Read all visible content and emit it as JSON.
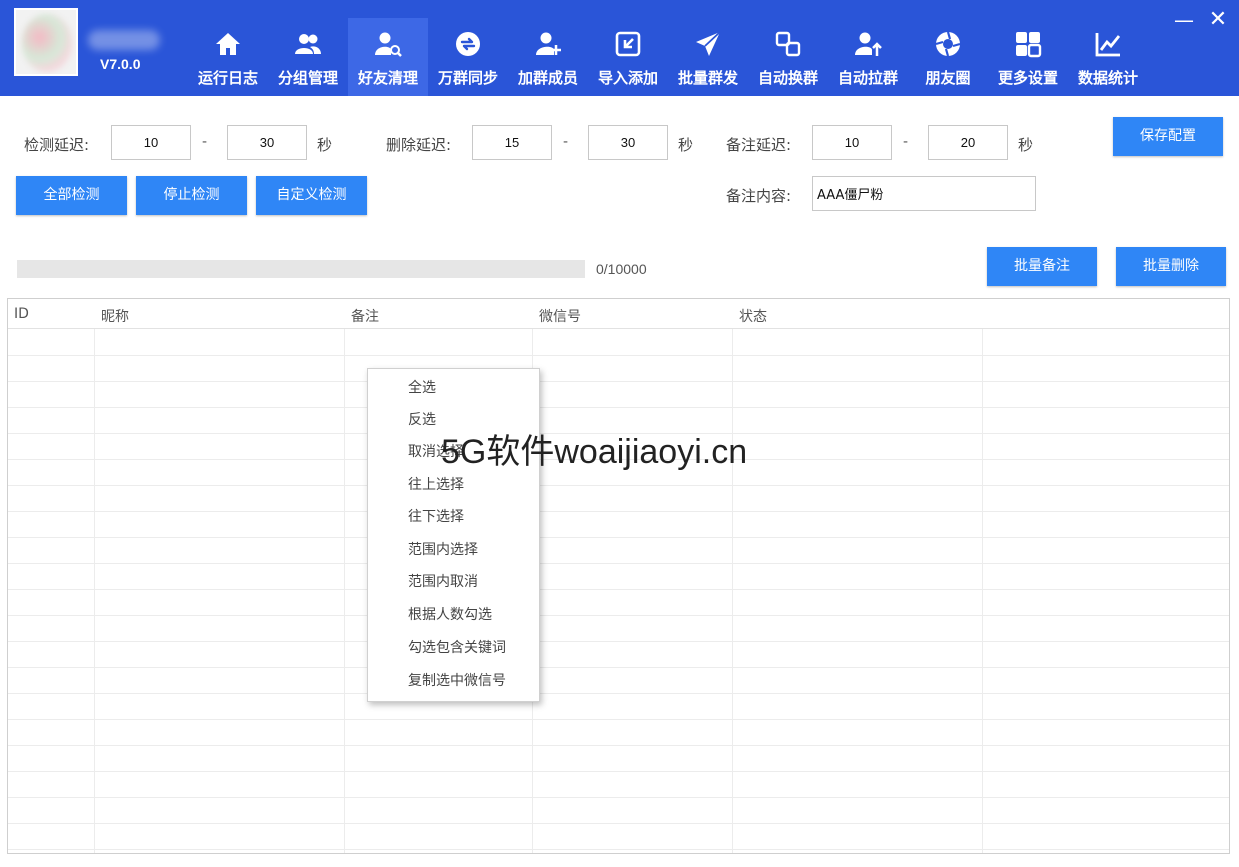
{
  "header": {
    "version": "V7.0.0",
    "nav": [
      {
        "label": "运行日志",
        "icon": "home-icon",
        "active": false
      },
      {
        "label": "分组管理",
        "icon": "users-icon",
        "active": false
      },
      {
        "label": "好友清理",
        "icon": "user-search-icon",
        "active": true
      },
      {
        "label": "万群同步",
        "icon": "sync-icon",
        "active": false
      },
      {
        "label": "加群成员",
        "icon": "user-add-icon",
        "active": false
      },
      {
        "label": "导入添加",
        "icon": "import-icon",
        "active": false
      },
      {
        "label": "批量群发",
        "icon": "send-icon",
        "active": false
      },
      {
        "label": "自动换群",
        "icon": "swap-icon",
        "active": false
      },
      {
        "label": "自动拉群",
        "icon": "pull-user-icon",
        "active": false
      },
      {
        "label": "朋友圈",
        "icon": "aperture-icon",
        "active": false
      },
      {
        "label": "更多设置",
        "icon": "grid-icon",
        "active": false
      },
      {
        "label": "数据统计",
        "icon": "chart-icon",
        "active": false
      }
    ],
    "minimize": "—",
    "close": "✕"
  },
  "settings": {
    "detect_delay_label": "检测延迟:",
    "detect_min": "10",
    "detect_max": "30",
    "delete_delay_label": "删除延迟:",
    "delete_min": "15",
    "delete_max": "30",
    "remark_delay_label": "备注延迟:",
    "remark_min": "10",
    "remark_max": "20",
    "sec": "秒",
    "dash": "-",
    "save": "保存配置",
    "remark_content_label": "备注内容:",
    "remark_content": "AAA僵尸粉"
  },
  "actions": {
    "detect_all": "全部检测",
    "stop_detect": "停止检测",
    "custom_detect": "自定义检测",
    "batch_remark": "批量备注",
    "batch_delete": "批量删除"
  },
  "progress": {
    "text": "0/10000",
    "value": 0,
    "total": 10000
  },
  "table": {
    "columns": [
      "ID",
      "昵称",
      "备注",
      "微信号",
      "状态"
    ]
  },
  "context_menu": [
    "全选",
    "反选",
    "取消选择",
    "往上选择",
    "往下选择",
    "范围内选择",
    "范围内取消",
    "根据人数勾选",
    "勾选包含关键词",
    "复制选中微信号"
  ],
  "watermark": "5G软件woaijiaoyi.cn"
}
